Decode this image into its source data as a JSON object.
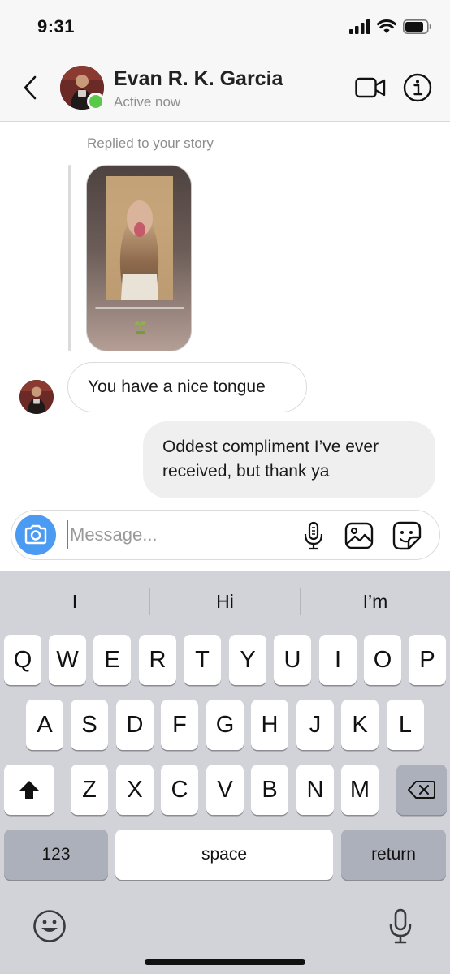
{
  "status_bar": {
    "time": "9:31"
  },
  "header": {
    "contact_name": "Evan R. K. Garcia",
    "contact_status": "Active now",
    "icons": [
      "back-chevron-icon",
      "video-camera-icon",
      "info-icon"
    ]
  },
  "chat": {
    "reply_label": "Replied to your story",
    "messages": [
      {
        "direction": "incoming",
        "text": "You have a nice tongue"
      },
      {
        "direction": "outgoing",
        "text": "Oddest compliment I’ve ever received, but thank ya"
      }
    ]
  },
  "composer": {
    "placeholder": "Message...",
    "value": "",
    "icons": [
      "camera-icon",
      "microphone-icon",
      "image-icon",
      "sticker-icon"
    ]
  },
  "keyboard": {
    "suggestions": [
      "I",
      "Hi",
      "I’m"
    ],
    "row1": [
      "Q",
      "W",
      "E",
      "R",
      "T",
      "Y",
      "U",
      "I",
      "O",
      "P"
    ],
    "row2": [
      "A",
      "S",
      "D",
      "F",
      "G",
      "H",
      "J",
      "K",
      "L"
    ],
    "row3": [
      "Z",
      "X",
      "C",
      "V",
      "B",
      "N",
      "M"
    ],
    "numbers_label": "123",
    "space_label": "space",
    "return_label": "return"
  },
  "colors": {
    "accent": "#4b9bf2",
    "online": "#5ac84a",
    "outgoing_bubble": "#efefef",
    "keyboard_bg": "#d1d3d9"
  }
}
